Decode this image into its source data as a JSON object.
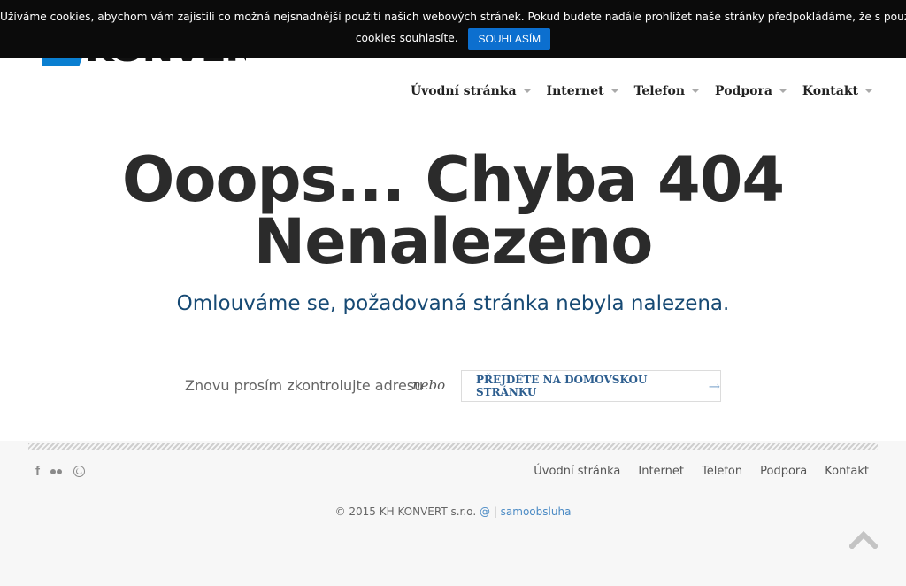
{
  "cookie_bar": {
    "message_line1": "Užíváme cookies, abychom vám zajistili co možná nejsnadnější použití našich webových stránek. Pokud budete nadále prohlížet naše stránky předpokládáme, že s použitím",
    "message_line2": "cookies souhlasíte.",
    "accept_label": "SOUHLASÍM"
  },
  "header": {
    "logo_text": "KONVERT",
    "nav": [
      "Úvodní stránka",
      "Internet",
      "Telefon",
      "Podpora",
      "Kontakt"
    ]
  },
  "error": {
    "title_line1": "Ooops... Chyba 404",
    "title_line2": "Nenalezeno",
    "subtitle": "Omlouváme se, požadovaná stránka nebyla nalezena.",
    "check_text": "Znovu prosím zkontrolujte adresu",
    "or_text": "nebo",
    "home_button": "PŘEJDĚTE NA DOMOVSKOU STRÁNKU",
    "home_arrow": "→"
  },
  "footer": {
    "social_icons": [
      "facebook-icon",
      "flickr-icon",
      "dribbble-icon"
    ],
    "facebook_glyph": "f",
    "nav": [
      "Úvodní stránka",
      "Internet",
      "Telefon",
      "Podpora",
      "Kontakt"
    ],
    "copyright": "© 2015 KH KONVERT s.r.o.",
    "at_link": "@",
    "separator": "|",
    "self_service": "samoobsluha"
  },
  "colors": {
    "accent": "#0c6fcf",
    "subtitle": "#174a74",
    "link": "#4a8ac4"
  }
}
